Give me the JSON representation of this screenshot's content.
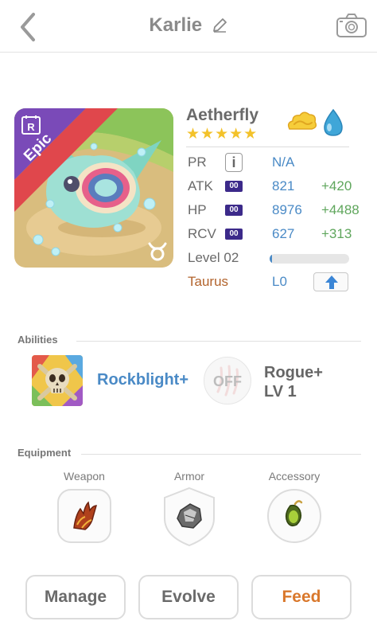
{
  "header": {
    "title": "Karlie"
  },
  "monster": {
    "rarity": "Epic",
    "name": "Aetherfly",
    "stars": "★★★★★",
    "star_count": 5,
    "elements": [
      "wind-cloud-icon",
      "water-drop-icon"
    ],
    "stats": {
      "pr": {
        "label": "PR",
        "value": "N/A"
      },
      "atk": {
        "label": "ATK",
        "badge": "00",
        "value": "821",
        "bonus": "+420"
      },
      "hp": {
        "label": "HP",
        "badge": "00",
        "value": "8976",
        "bonus": "+4488"
      },
      "rcv": {
        "label": "RCV",
        "badge": "00",
        "value": "627",
        "bonus": "+313"
      }
    },
    "level": {
      "label": "Level 02",
      "progress": 0.03
    },
    "zodiac": {
      "name": "Taurus",
      "level": "L0"
    }
  },
  "abilities": {
    "title": "Abilities",
    "active": {
      "name": "Rockblight+"
    },
    "passive": {
      "status": "OFF",
      "name_line1": "Rogue+",
      "name_line2": "LV 1"
    }
  },
  "equipment": {
    "title": "Equipment",
    "slots": [
      {
        "label": "Weapon"
      },
      {
        "label": "Armor"
      },
      {
        "label": "Accessory"
      }
    ]
  },
  "actions": {
    "manage": "Manage",
    "evolve": "Evolve",
    "feed": "Feed"
  },
  "colors": {
    "stat_value": "#4a8ac6",
    "stat_bonus": "#5fa65c",
    "zodiac": "#b2632c",
    "feed": "#d9782c",
    "stars": "#f3c22a",
    "epic_ribbon": "#e0474c"
  }
}
